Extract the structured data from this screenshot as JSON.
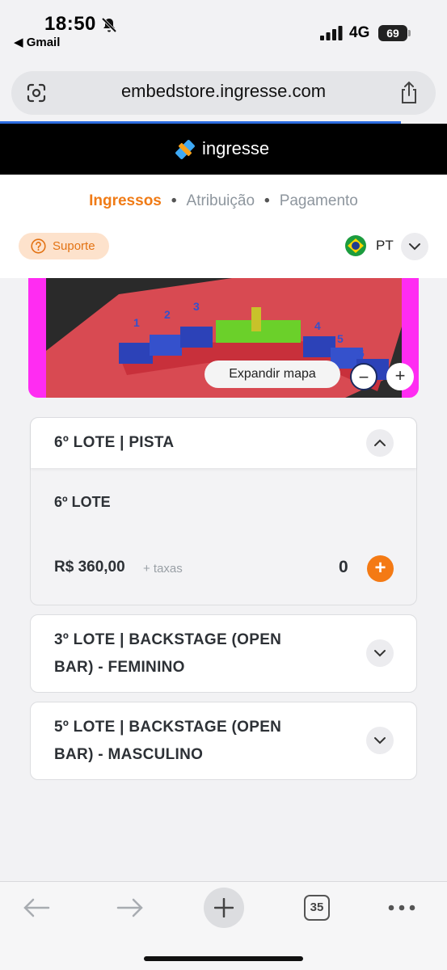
{
  "status_bar": {
    "time": "18:50",
    "back_app": "◀ Gmail",
    "network": "4G",
    "battery": "69"
  },
  "browser": {
    "url": "embedstore.ingresse.com"
  },
  "brand": {
    "name": "ingresse",
    "accent": "#f07b16"
  },
  "steps": [
    "Ingressos",
    "Atribuição",
    "Pagamento"
  ],
  "support": {
    "label": "Suporte"
  },
  "language": {
    "code": "PT"
  },
  "map": {
    "expand_label": "Expandir mapa",
    "zoom_out": "−",
    "zoom_in": "+"
  },
  "tickets": [
    {
      "title": "6º LOTE | PISTA",
      "lot": "6º LOTE",
      "price": "R$ 360,00",
      "fees": "+ taxas",
      "quantity": "0",
      "add": "+"
    },
    {
      "title_line1": "3º LOTE | BACKSTAGE (OPEN",
      "title_line2": "BAR) - FEMININO"
    },
    {
      "title_line1": "5º LOTE | BACKSTAGE (OPEN",
      "title_line2": "BAR) - MASCULINO"
    }
  ],
  "toolbar": {
    "tabs_count": "35"
  }
}
